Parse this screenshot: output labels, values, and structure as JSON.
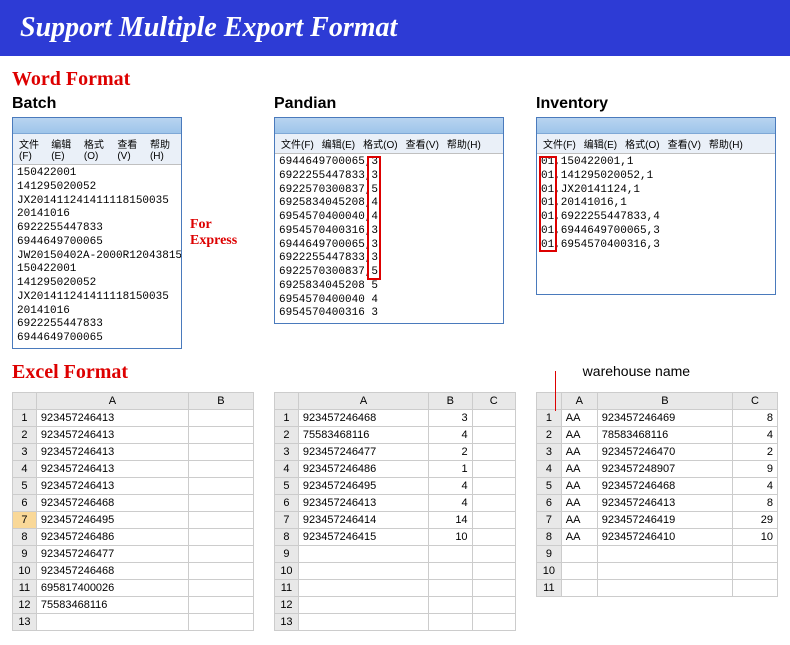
{
  "header": "Support Multiple Export Format",
  "labels": {
    "wordFormat": "Word Format",
    "excelFormat": "Excel Format",
    "forExpress1": "For",
    "forExpress2": "Express",
    "warehouseName": "warehouse name"
  },
  "cols": {
    "batch": "Batch",
    "pandian": "Pandian",
    "inventory": "Inventory"
  },
  "menubar": {
    "file": "文件(F)",
    "edit": "编辑(E)",
    "format": "格式(O)",
    "view": "查看(V)",
    "help": "帮助(H)"
  },
  "notepad": {
    "batch": [
      "150422001",
      "141295020052",
      "JX201411241411118150035",
      "20141016",
      "6922255447833",
      "6944649700065",
      "JW20150402A-2000R12043815",
      "150422001",
      "141295020052",
      "JX201411241411118150035",
      "20141016",
      "6922255447833",
      "6944649700065"
    ],
    "pandian": [
      "6944649700065,3",
      "6922255447833,3",
      "6922570300837,5",
      "6925834045208,4",
      "6954570400040,4",
      "6954570400316,3",
      "6944649700065,3",
      "6922255447833,3",
      "6922570300837,5",
      "6925834045208 5",
      "6954570400040 4",
      "6954570400316 3"
    ],
    "inventory": [
      "01,150422001,1",
      "01,141295020052,1",
      "01,JX20141124,1",
      "01,20141016,1",
      "01,6922255447833,4",
      "01,6944649700065,3",
      "01,6954570400316,3"
    ]
  },
  "excel": {
    "batch": {
      "headers": [
        "A",
        "B"
      ],
      "rows": [
        [
          "923457246413",
          ""
        ],
        [
          "923457246413",
          ""
        ],
        [
          "923457246413",
          ""
        ],
        [
          "923457246413",
          ""
        ],
        [
          "923457246413",
          ""
        ],
        [
          "923457246468",
          ""
        ],
        [
          "923457246495",
          ""
        ],
        [
          "923457246486",
          ""
        ],
        [
          "923457246477",
          ""
        ],
        [
          "923457246468",
          ""
        ],
        [
          "695817400026",
          ""
        ],
        [
          "75583468116",
          ""
        ],
        [
          "",
          ""
        ]
      ]
    },
    "pandian": {
      "headers": [
        "A",
        "B",
        "C"
      ],
      "rows": [
        [
          "923457246468",
          "3",
          ""
        ],
        [
          "75583468116",
          "4",
          ""
        ],
        [
          "923457246477",
          "2",
          ""
        ],
        [
          "923457246486",
          "1",
          ""
        ],
        [
          "923457246495",
          "4",
          ""
        ],
        [
          "923457246413",
          "4",
          ""
        ],
        [
          "923457246414",
          "14",
          ""
        ],
        [
          "923457246415",
          "10",
          ""
        ],
        [
          "",
          "",
          ""
        ],
        [
          "",
          "",
          ""
        ],
        [
          "",
          "",
          ""
        ],
        [
          "",
          "",
          ""
        ],
        [
          "",
          "",
          ""
        ]
      ]
    },
    "inventory": {
      "headers": [
        "A",
        "B",
        "C"
      ],
      "rows": [
        [
          "AA",
          "923457246469",
          "8"
        ],
        [
          "AA",
          "78583468116",
          "4"
        ],
        [
          "AA",
          "923457246470",
          "2"
        ],
        [
          "AA",
          "923457248907",
          "9"
        ],
        [
          "AA",
          "923457246468",
          "4"
        ],
        [
          "AA",
          "923457246413",
          "8"
        ],
        [
          "AA",
          "923457246419",
          "29"
        ],
        [
          "AA",
          "923457246410",
          "10"
        ],
        [
          "",
          "",
          ""
        ],
        [
          "",
          "",
          ""
        ],
        [
          "",
          "",
          ""
        ]
      ]
    }
  }
}
